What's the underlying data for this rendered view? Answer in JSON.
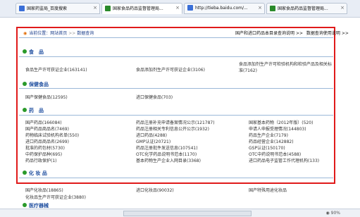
{
  "tabs": [
    {
      "title": "国家药监局_百度搜索",
      "color": "#3a6fd8"
    },
    {
      "title": "国家食品药品监督管理局...",
      "color": "#2a8a2a"
    },
    {
      "title": "http://tieba.baidu.com/...",
      "color": "#3a6fd8"
    },
    {
      "title": "国家食品药品监督管理局...",
      "color": "#2a8a2a"
    }
  ],
  "breadcrumb": {
    "label": "当前位置：",
    "home": "网站首页",
    "sep": ">>",
    "current": "数据查询"
  },
  "toplinks": {
    "link1": "国产和进口药品本目录查询说明",
    "sep": ">>",
    "link2": "数据查询使用说明",
    "arrow": ">>"
  },
  "sections": {
    "food": {
      "title": "食　品",
      "items": [
        "食品生产许可获证企业(163141)",
        "食品添加剂生产许可获证企业(3106)",
        "食品添加剂生产许可检验机构和检验产品及相关标准(7162)"
      ]
    },
    "health": {
      "title": "保健食品",
      "items": [
        "国产保健食品(12595)",
        "进口保健食品(703)"
      ]
    },
    "drug": {
      "title": "药　品",
      "col1": [
        "国产药品(166084)",
        "国产药品商品名(7469)",
        "药物临床试验机构名单(550)",
        "进口药品商品名(2699)",
        "批准的药包材(5730)",
        "中药保护品种(695)",
        "药品行政保护(1)"
      ],
      "col2": [
        "药品注册补充申请备案情况公示(121787)",
        "药品注册相关专利信息公开公示(1932)",
        "进口药品(4288)",
        "GMP认证(20721)",
        "药品注册批件发送信息(107541)",
        "OTC化学药品说明书范本(1170)",
        "基本药物生产企业入网目录(3368)"
      ],
      "col3": [
        "国家基本药物（2012年版）(520)",
        "申请人申报受理情况(144803)",
        "药品生产企业(7179)",
        "药品经营企业(142882)",
        "GSP认证(150170)",
        "OTC中药说明书范本(4588)",
        "进口药品电子监管工作代理机构(133)"
      ]
    },
    "cosmetic": {
      "title": "化 妆 品",
      "items": [
        "国产化妆品(18865)",
        "进口化妆品(90032)",
        "国产特殊用途化妆品",
        "化妆品生产许可获证企业(3880)"
      ]
    },
    "device": {
      "title": "医疗器械"
    }
  },
  "status": {
    "zoom": "◉ 90%"
  },
  "colors": {
    "frame": "#e01a1a",
    "link": "#1f4fa0",
    "rule": "#9bb8d8"
  }
}
